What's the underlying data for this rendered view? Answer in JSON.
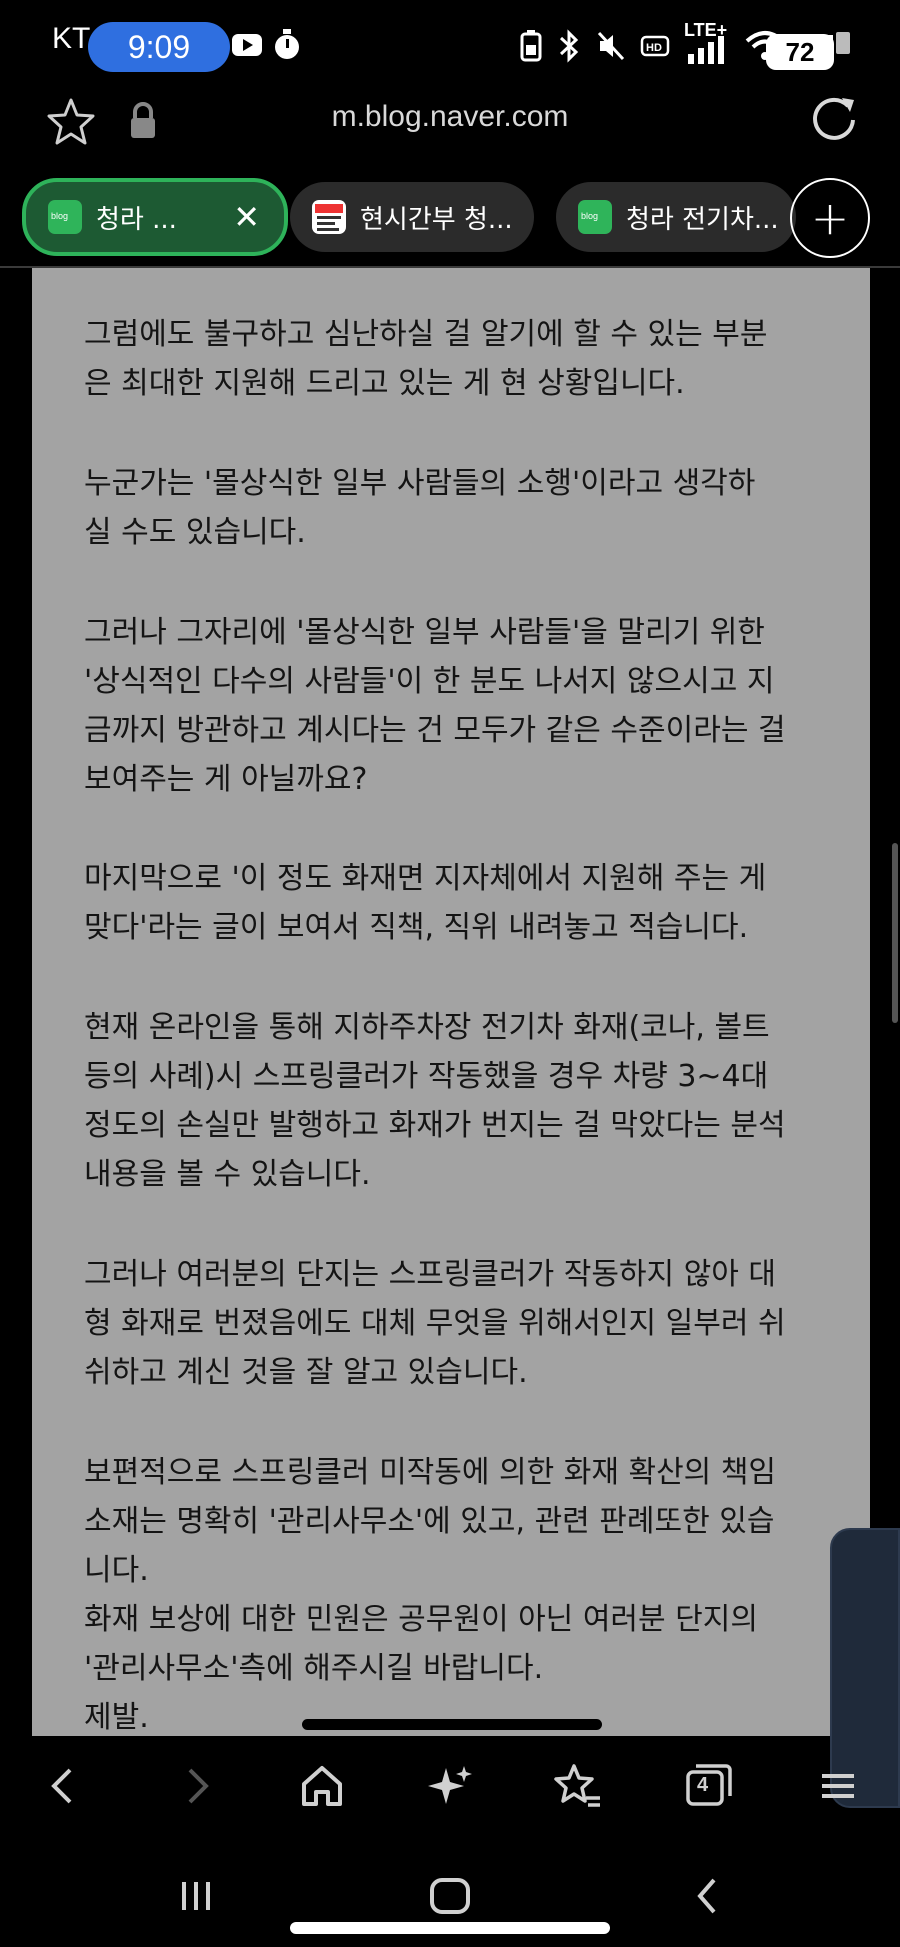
{
  "status_bar": {
    "carrier": "KT",
    "time": "9:09",
    "network": "LTE+",
    "battery": "72"
  },
  "browser": {
    "url": "m.blog.naver.com",
    "tabs": [
      {
        "label": "청라 ...",
        "favicon": "blog-icon",
        "active": true
      },
      {
        "label": "현시간부 청...",
        "favicon": "news-icon",
        "active": false
      },
      {
        "label": "청라 전기차...",
        "favicon": "blog-icon",
        "active": false
      }
    ]
  },
  "article": {
    "paragraphs": [
      [
        "그럼에도 불구하고 심난하실 걸 알기에 할 수 있는 부분",
        "은 최대한 지원해 드리고 있는 게 현 상황입니다."
      ],
      [
        "누군가는 '몰상식한 일부 사람들의 소행'이라고 생각하",
        "실 수도 있습니다."
      ],
      [
        "그러나 그자리에 '몰상식한 일부 사람들'을 말리기 위한",
        "'상식적인 다수의 사람들'이 한 분도 나서지 않으시고 지",
        "금까지 방관하고 계시다는 건 모두가 같은 수준이라는 걸",
        "보여주는 게 아닐까요?"
      ],
      [
        "마지막으로 '이 정도 화재면 지자체에서 지원해 주는 게",
        "맞다'라는 글이 보여서 직책, 직위 내려놓고 적습니다."
      ],
      [
        "현재 온라인을 통해 지하주차장 전기차 화재(코나, 볼트",
        "등의 사례)시 스프링클러가 작동했을 경우 차량 3~4대",
        "정도의 손실만 발행하고 화재가 번지는 걸 막았다는 분석",
        "내용을 볼 수 있습니다."
      ],
      [
        "그러나 여러분의 단지는 스프링클러가 작동하지 않아 대",
        "형 화재로 번졌음에도 대체 무엇을 위해서인지 일부러 쉬",
        "쉬하고 계신 것을 잘 알고 있습니다."
      ],
      [
        "보편적으로 스프링클러 미작동에 의한 화재 확산의 책임",
        "소재는 명확히 '관리사무소'에 있고, 관련 판례또한 있습",
        "니다.",
        "화재 보상에 대한 민원은 공무원이 아닌 여러분 단지의",
        "'관리사무소'측에 해주시길 바랍니다.",
        "제발."
      ]
    ]
  },
  "bottom_nav": {
    "tab_count": "4"
  }
}
